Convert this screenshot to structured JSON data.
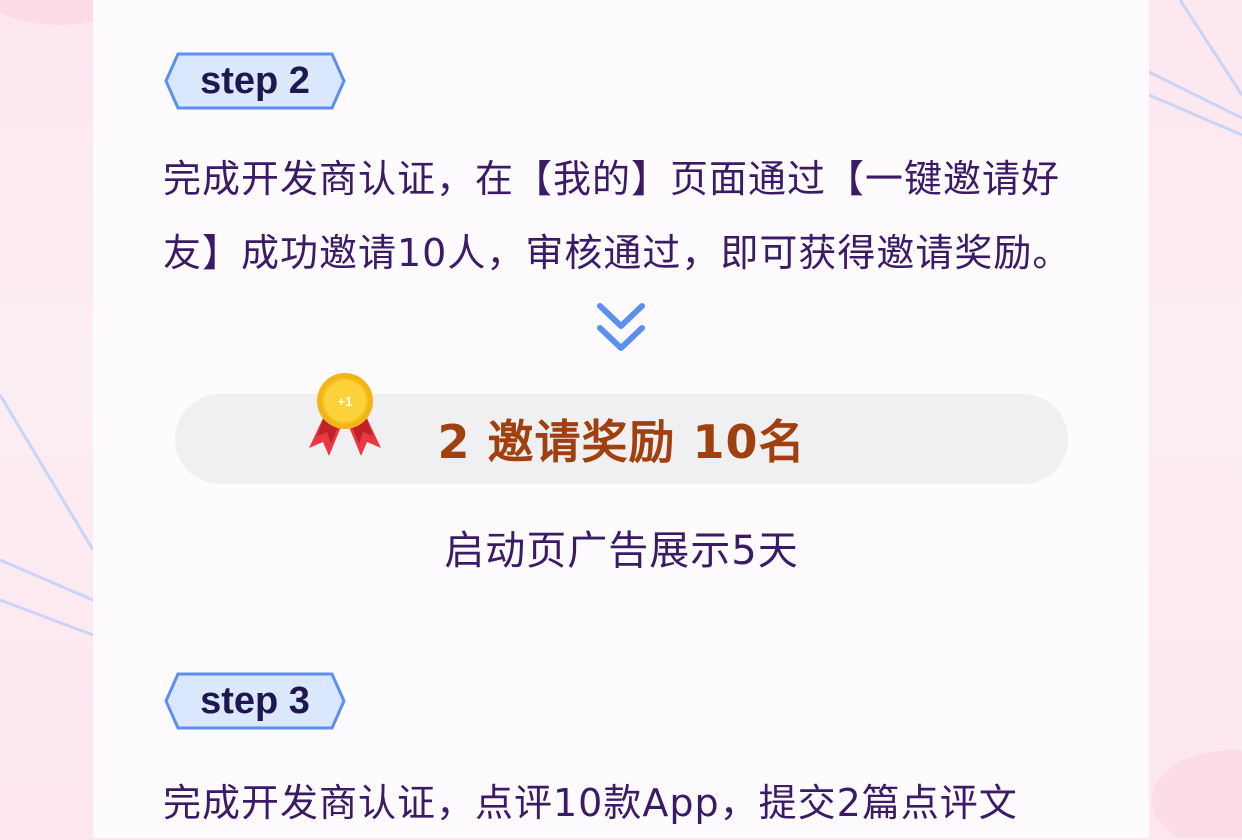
{
  "step2": {
    "tag": "step 2",
    "description": "完成开发商认证，在【我的】页面通过【一键邀请好友】成功邀请10人，审核通过，即可获得邀请奖励。"
  },
  "reward": {
    "badge_text": "+1",
    "title": "2 邀请奖励 10名",
    "description": "启动页广告展示5天"
  },
  "step3": {
    "tag": "step 3",
    "description": "完成开发商认证，点评10款App，提交2篇点评文"
  },
  "colors": {
    "page_bg": "#fde7ef",
    "card_bg": "#fdfbfd",
    "tag_fill": "#dbe7fd",
    "tag_border": "#5b8ff0",
    "text_primary": "#3b1a66",
    "reward_text": "#a0400f",
    "reward_bar": "#f0eff2",
    "chevron": "#5b8ff0"
  }
}
